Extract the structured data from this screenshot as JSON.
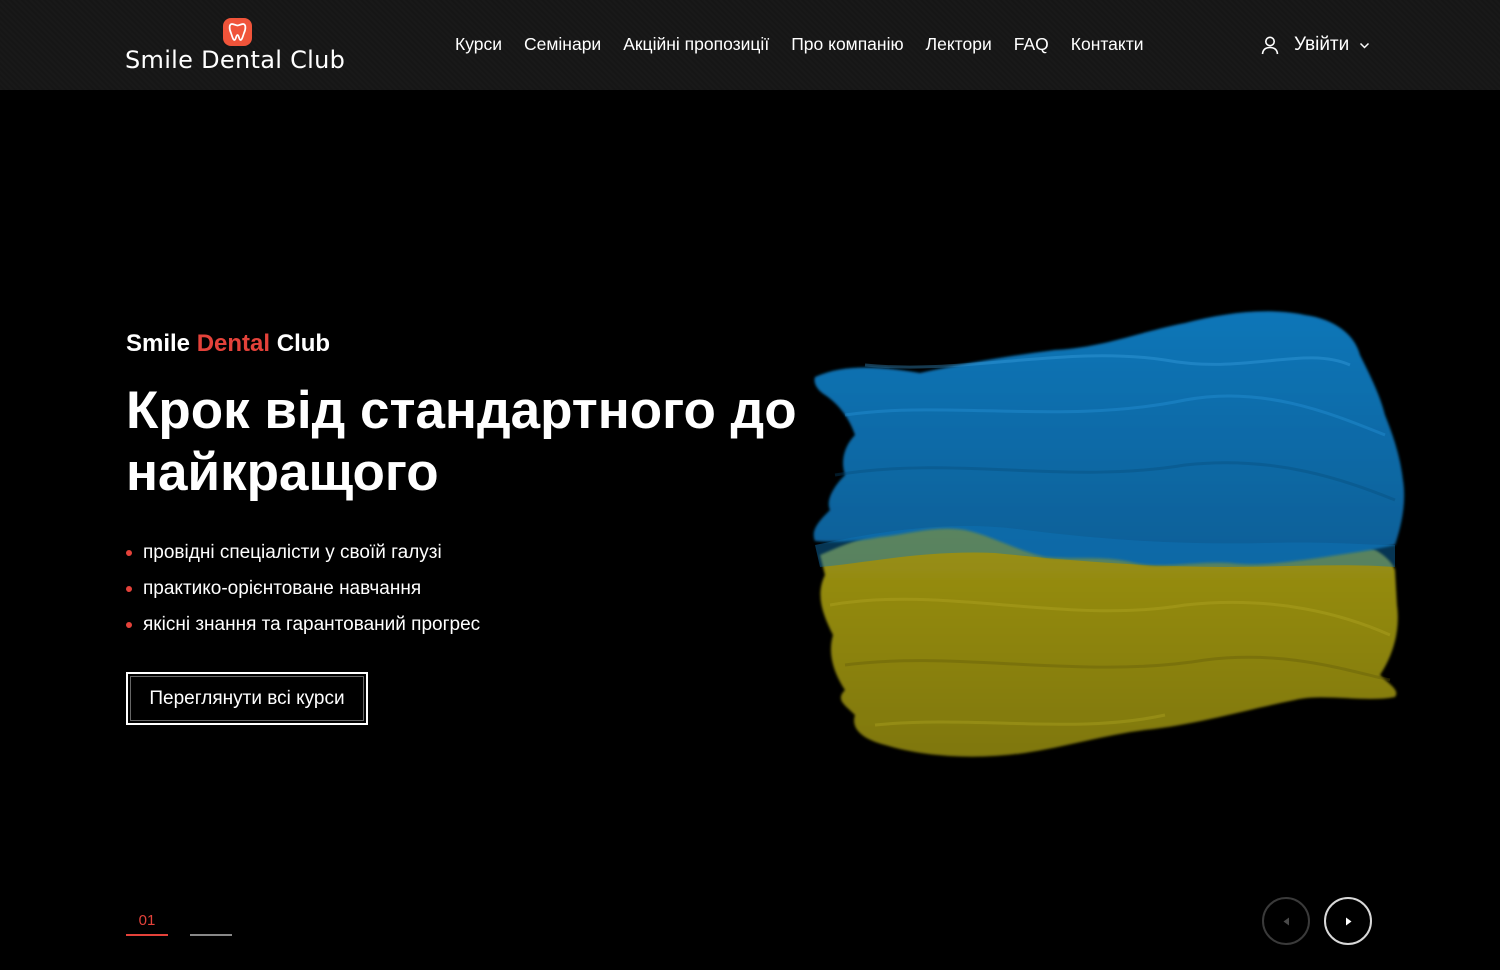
{
  "header": {
    "logo_text": "Smile Dental Club",
    "nav": [
      {
        "label": "Курси"
      },
      {
        "label": "Семінари"
      },
      {
        "label": "Акційні пропозиції"
      },
      {
        "label": "Про компанію"
      },
      {
        "label": "Лектори"
      },
      {
        "label": "FAQ"
      },
      {
        "label": "Контакти"
      }
    ],
    "login_label": "Увійти"
  },
  "hero": {
    "tagline_part1": "Smile",
    "tagline_part2": "Dental",
    "tagline_part3": "Club",
    "title": "Крок від стандартного до найкращого",
    "features": [
      "провідні спеціалісти у своїй галузі",
      "практико-орієнтоване навчання",
      "якісні знання та гарантований прогрес"
    ],
    "cta_label": "Переглянути всі курси"
  },
  "slider": {
    "current": "01"
  },
  "colors": {
    "accent": "#e4423a",
    "logo_badge": "#f0543a",
    "background": "#000000",
    "header_bg": "#161616",
    "flag_blue": "#0a6aa8",
    "flag_yellow": "#8f860d"
  },
  "icons": {
    "logo": "tooth-icon",
    "login": "user-icon",
    "login_dropdown": "chevron-down-icon",
    "prev": "arrow-left-icon",
    "next": "arrow-right-icon"
  }
}
